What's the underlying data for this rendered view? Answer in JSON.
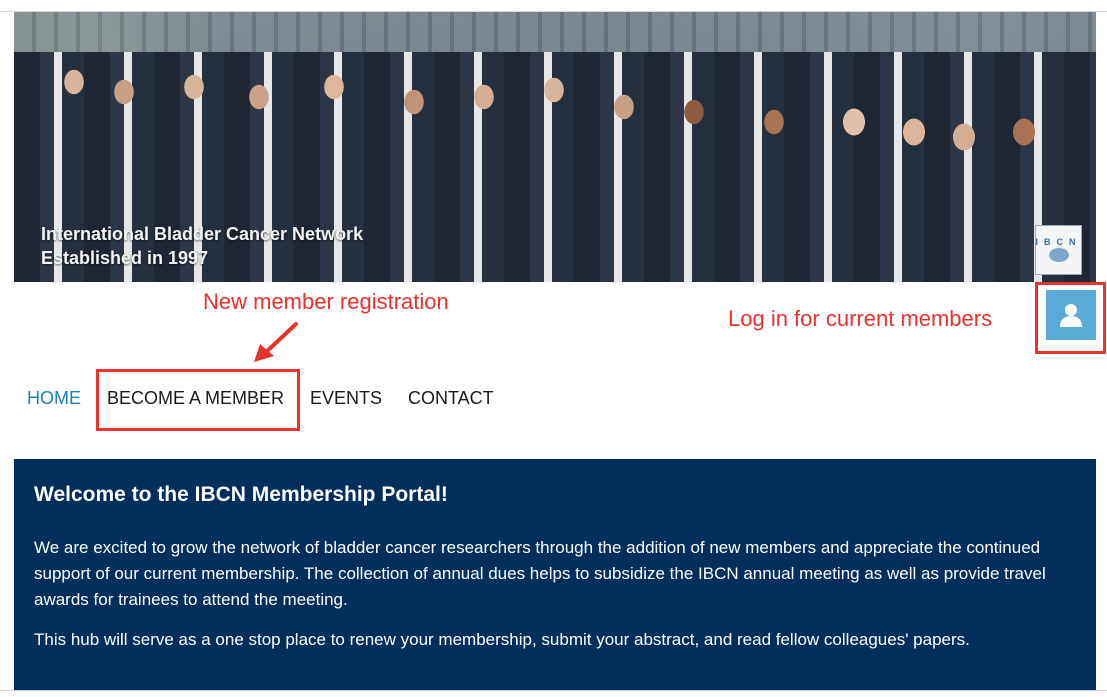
{
  "hero": {
    "caption_line1": "International Bladder Cancer Network",
    "caption_line2": "Established in 1997",
    "logo_text": "IBCN"
  },
  "annotations": {
    "new_member": "New member registration",
    "login": "Log in for current members"
  },
  "nav": {
    "home": "HOME",
    "become_member": "BECOME A MEMBER",
    "events": "EVENTS",
    "contact": "CONTACT"
  },
  "welcome": {
    "title": "Welcome to the IBCN Membership Portal!",
    "paragraph1": "We are excited to grow the network of bladder cancer researchers through the addition of new members and appreciate the continued support of our current membership. The collection of annual dues helps to subsidize the IBCN annual meeting as well as provide travel awards for trainees to attend the meeting.",
    "paragraph2": "This hub will serve as a one stop place to renew your membership, submit your abstract, and read fellow colleagues' papers."
  },
  "colors": {
    "annotation_red": "#e8322c",
    "nav_active": "#1d82b4",
    "panel_navy": "#002e5d",
    "login_blue": "#5aaad6"
  },
  "icons": {
    "login": "user-icon"
  }
}
